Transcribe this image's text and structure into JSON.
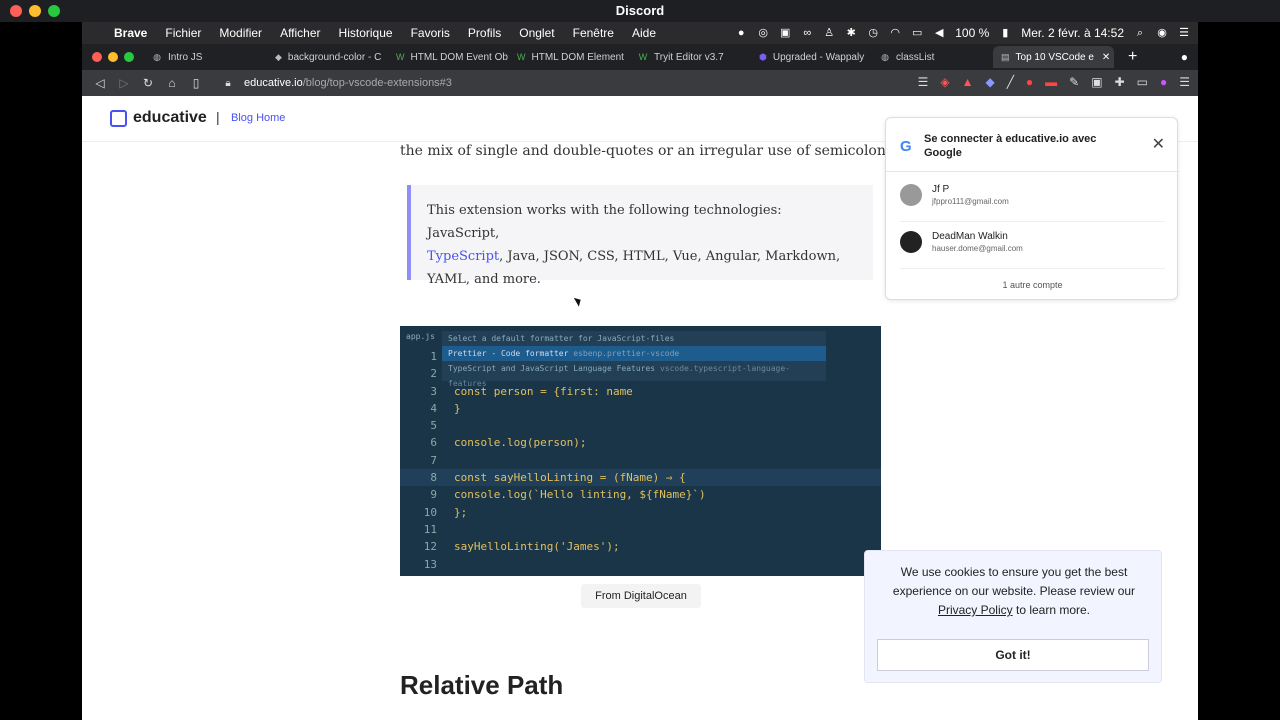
{
  "outer": {
    "title": "Discord"
  },
  "menubar": {
    "apple": "",
    "items": [
      "Brave",
      "Fichier",
      "Modifier",
      "Afficher",
      "Historique",
      "Favoris",
      "Profils",
      "Onglet",
      "Fenêtre",
      "Aide"
    ],
    "battery": "100 %",
    "datetime": "Mer. 2 févr. à 14:52"
  },
  "tabs": [
    {
      "label": "Intro JS",
      "icon": "globe-icon"
    },
    {
      "label": "background-color - C",
      "icon": "page-icon"
    },
    {
      "label": "HTML DOM Event Ob",
      "icon": "w3-icon"
    },
    {
      "label": "HTML DOM Element",
      "icon": "w3-icon"
    },
    {
      "label": "Tryit Editor v3.7",
      "icon": "w3-icon"
    },
    {
      "label": "Upgraded - Wappaly",
      "icon": "hex-icon"
    },
    {
      "label": "classList",
      "icon": "globe-icon"
    },
    {
      "label": "Top 10 VSCode e",
      "icon": "page-icon",
      "active": true
    }
  ],
  "url": {
    "host": "educative.io",
    "path": "/blog/top-vscode-extensions#3"
  },
  "site": {
    "logo": "educative",
    "sep": "|",
    "blog_home": "Blog Home"
  },
  "article": {
    "line": "the mix of single and double-quotes or an irregular use of semicolons.",
    "quote_pre": "This extension works with the following technologies: JavaScript,",
    "quote_link": "TypeScript",
    "quote_rest1": ", Java, JSON, CSS, HTML, Vue, Angular, Markdown,",
    "quote_rest2": "YAML, and more.",
    "caption": "From DigitalOcean",
    "heading": "Relative Path"
  },
  "code": {
    "file": "app.js",
    "cmd_placeholder": "Select a default formatter for JavaScript-files",
    "cmd_opt1": "Prettier - Code formatter",
    "cmd_opt1_id": "esbenp.prettier-vscode",
    "cmd_opt2": "TypeScript and JavaScript Language Features",
    "cmd_opt2_id": "vscode.typescript-language-features",
    "lines": [
      {
        "n": "1",
        "t": ""
      },
      {
        "n": "2",
        "t": ""
      },
      {
        "n": "3",
        "t": "const person = {first: name"
      },
      {
        "n": "4",
        "t": "}"
      },
      {
        "n": "5",
        "t": ""
      },
      {
        "n": "6",
        "t": "console.log(person);"
      },
      {
        "n": "7",
        "t": ""
      },
      {
        "n": "8",
        "t": "const sayHelloLinting = (fName) ⇒ {"
      },
      {
        "n": "9",
        "t": "console.log(`Hello linting, ${fName}`)"
      },
      {
        "n": "10",
        "t": "};"
      },
      {
        "n": "11",
        "t": ""
      },
      {
        "n": "12",
        "t": "sayHelloLinting('James');"
      },
      {
        "n": "13",
        "t": ""
      }
    ]
  },
  "google": {
    "title": "Se connecter à educative.io avec Google",
    "accounts": [
      {
        "name": "Jf P",
        "email": "jfppro111@gmail.com"
      },
      {
        "name": "DeadMan Walkin",
        "email": "hauser.dome@gmail.com"
      }
    ],
    "more": "1 autre compte"
  },
  "cookie": {
    "msg1": "We use cookies to ensure you get the best experience on our website. Please review our",
    "link": "Privacy Policy",
    "msg2": "to learn more.",
    "button": "Got it!"
  }
}
